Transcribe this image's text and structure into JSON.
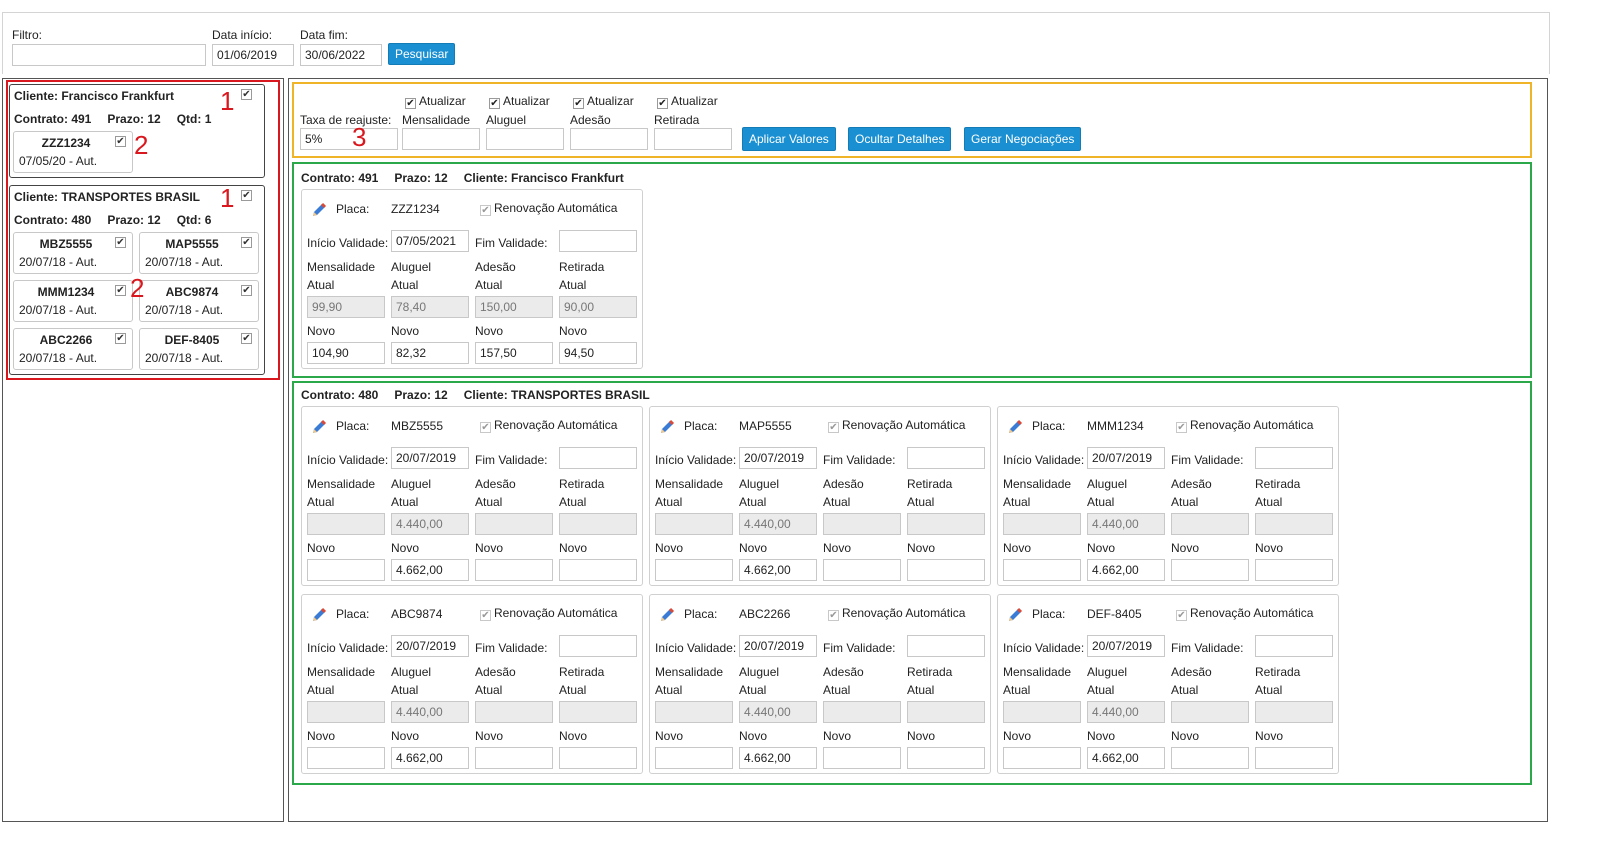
{
  "filter": {
    "filtro_label": "Filtro:",
    "filtro_value": "",
    "inicio_label": "Data início:",
    "inicio_value": "01/06/2019",
    "fim_label": "Data fim:",
    "fim_value": "30/06/2022",
    "search_label": "Pesquisar"
  },
  "annotations": {
    "one": "1",
    "two": "2",
    "three": "3"
  },
  "left": {
    "clients": [
      {
        "title": "Cliente: Francisco Frankfurt",
        "contrato": "Contrato: 491",
        "prazo": "Prazo: 12",
        "qtd": "Qtd: 1",
        "plates": [
          {
            "name": "ZZZ1234",
            "date": "07/05/20 - Aut."
          }
        ]
      },
      {
        "title": "Cliente: TRANSPORTES BRASIL",
        "contrato": "Contrato: 480",
        "prazo": "Prazo: 12",
        "qtd": "Qtd: 6",
        "plates": [
          {
            "name": "MBZ5555",
            "date": "20/07/18 - Aut."
          },
          {
            "name": "MAP5555",
            "date": "20/07/18 - Aut."
          },
          {
            "name": "MMM1234",
            "date": "20/07/18 - Aut."
          },
          {
            "name": "ABC9874",
            "date": "20/07/18 - Aut."
          },
          {
            "name": "ABC2266",
            "date": "20/07/18 - Aut."
          },
          {
            "name": "DEF-8405",
            "date": "20/07/18 - Aut."
          }
        ]
      }
    ]
  },
  "controls": {
    "atualizar": "Atualizar",
    "taxa_label": "Taxa de reajuste:",
    "taxa_value": "5%",
    "mensalidade": "Mensalidade",
    "aluguel": "Aluguel",
    "adesao": "Adesão",
    "retirada": "Retirada",
    "aplicar": "Aplicar Valores",
    "ocultar": "Ocultar Detalhes",
    "gerar": "Gerar Negociações"
  },
  "labels": {
    "placa": "Placa:",
    "renovacao": "Renovação Automática",
    "inicio": "Início Validade:",
    "fim": "Fim Validade:",
    "mensalidade": "Mensalidade",
    "aluguel": "Aluguel",
    "adesao": "Adesão",
    "retirada": "Retirada",
    "atual": "Atual",
    "novo": "Novo"
  },
  "groups": [
    {
      "contrato": "Contrato: 491",
      "prazo": "Prazo: 12",
      "cliente": "Cliente: Francisco Frankfurt",
      "vehicles": [
        {
          "placa": "ZZZ1234",
          "inicio": "07/05/2021",
          "fim": "",
          "atual": [
            "99,90",
            "78,40",
            "150,00",
            "90,00"
          ],
          "novo": [
            "104,90",
            "82,32",
            "157,50",
            "94,50"
          ]
        }
      ]
    },
    {
      "contrato": "Contrato: 480",
      "prazo": "Prazo: 12",
      "cliente": "Cliente: TRANSPORTES BRASIL",
      "vehicles": [
        {
          "placa": "MBZ5555",
          "inicio": "20/07/2019",
          "fim": "",
          "atual": [
            "",
            "4.440,00",
            "",
            ""
          ],
          "novo": [
            "",
            "4.662,00",
            "",
            ""
          ]
        },
        {
          "placa": "MAP5555",
          "inicio": "20/07/2019",
          "fim": "",
          "atual": [
            "",
            "4.440,00",
            "",
            ""
          ],
          "novo": [
            "",
            "4.662,00",
            "",
            ""
          ]
        },
        {
          "placa": "MMM1234",
          "inicio": "20/07/2019",
          "fim": "",
          "atual": [
            "",
            "4.440,00",
            "",
            ""
          ],
          "novo": [
            "",
            "4.662,00",
            "",
            ""
          ]
        },
        {
          "placa": "ABC9874",
          "inicio": "20/07/2019",
          "fim": "",
          "atual": [
            "",
            "4.440,00",
            "",
            ""
          ],
          "novo": [
            "",
            "4.662,00",
            "",
            ""
          ]
        },
        {
          "placa": "ABC2266",
          "inicio": "20/07/2019",
          "fim": "",
          "atual": [
            "",
            "4.440,00",
            "",
            ""
          ],
          "novo": [
            "",
            "4.662,00",
            "",
            ""
          ]
        },
        {
          "placa": "DEF-8405",
          "inicio": "20/07/2019",
          "fim": "",
          "atual": [
            "",
            "4.440,00",
            "",
            ""
          ],
          "novo": [
            "",
            "4.662,00",
            "",
            ""
          ]
        }
      ]
    }
  ],
  "colors": {
    "button": "#1a8fd1",
    "annotation_red": "#d8181e",
    "annotation_yellow": "#f0b429",
    "annotation_green": "#2aa84a"
  },
  "icons": {
    "edit": "pencil-icon",
    "check": "checkbox-checked-icon"
  }
}
